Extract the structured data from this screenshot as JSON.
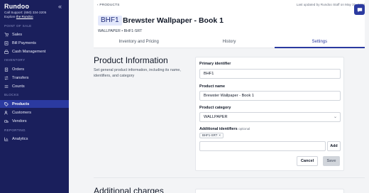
{
  "sidebar": {
    "brand": "Rundoo",
    "support_line": "Call Support: (650) 334-3205",
    "explore_prefix": "Explore ",
    "explore_link": "the Rundoo",
    "sections": {
      "pos": "POINT OF SALE",
      "inventory": "INVENTORY",
      "blocks": "BLOCKS",
      "reporting": "REPORTING"
    },
    "items": {
      "sales": "Sales",
      "bill_payments": "Bill Payments",
      "cash_management": "Cash Management",
      "orders": "Orders",
      "transfers": "Transfers",
      "counts": "Counts",
      "products": "Products",
      "customers": "Customers",
      "vendors": "Vendors",
      "analytics": "Analytics"
    }
  },
  "header": {
    "breadcrumb": "PRODUCTS",
    "updated": "Last updated by Rundoo Staff on May 31, 2024",
    "badge": "BHF1",
    "title": "Brewster Wallpaper - Book 1",
    "subtitle": "WALLPAPER • BHF1-SRT",
    "tabs": [
      "Inventory and Pricing",
      "History",
      "Settings"
    ]
  },
  "section": {
    "title": "Product Information",
    "description": "Set general product information, including its name, identifiers, and category",
    "next_title": "Additional charges"
  },
  "form": {
    "primary_identifier_label": "Primary identifier",
    "primary_identifier_value": "BHF1",
    "product_name_label": "Product name",
    "product_name_value": "Brewster Wallpaper - Book 1",
    "category_label": "Product category",
    "category_value": "WALLPAPER",
    "additional_label": "Additional identifiers",
    "optional": "optional",
    "chip": "BHF1-SRT",
    "add_button": "Add",
    "cancel_button": "Cancel",
    "save_button": "Save"
  },
  "colors": {
    "sidebar_bg": "#1a1f5c",
    "accent": "#2b3aa0"
  }
}
